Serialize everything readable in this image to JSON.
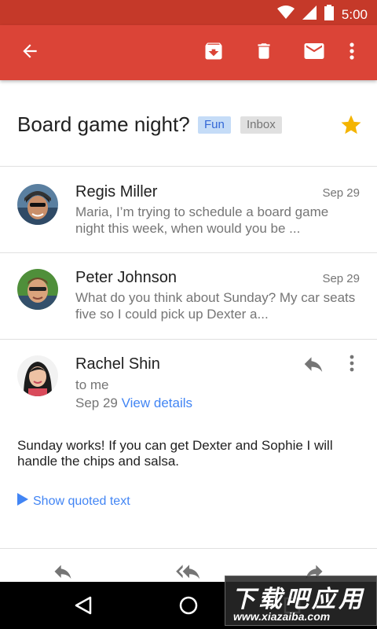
{
  "status_bar": {
    "time": "5:00"
  },
  "app_bar": {
    "icons": [
      "back-arrow-icon",
      "archive-icon",
      "delete-icon",
      "mark-unread-icon",
      "overflow-menu-icon"
    ],
    "color": "#db4437"
  },
  "thread": {
    "subject": "Board game night?",
    "labels": [
      "Fun",
      "Inbox"
    ],
    "starred": true,
    "star_color": "#f4b400"
  },
  "messages": [
    {
      "sender": "Regis Miller",
      "date": "Sep 29",
      "snippet": "Maria, I’m trying to schedule a board game night this week, when would you be ..."
    },
    {
      "sender": "Peter Johnson",
      "date": "Sep 29",
      "snippet": "What do you think about Sunday? My car seats five so I could pick up Dexter a..."
    }
  ],
  "expanded_message": {
    "sender": "Rachel Shin",
    "to": "to me",
    "date": "Sep 29",
    "view_details": "View details",
    "body": "Sunday works! If you can get Dexter and Sophie I will handle the chips and salsa.",
    "show_quoted": "Show quoted text"
  },
  "watermark": {
    "text_cn": "下载吧应用",
    "url": "www.xiazaiba.com"
  }
}
